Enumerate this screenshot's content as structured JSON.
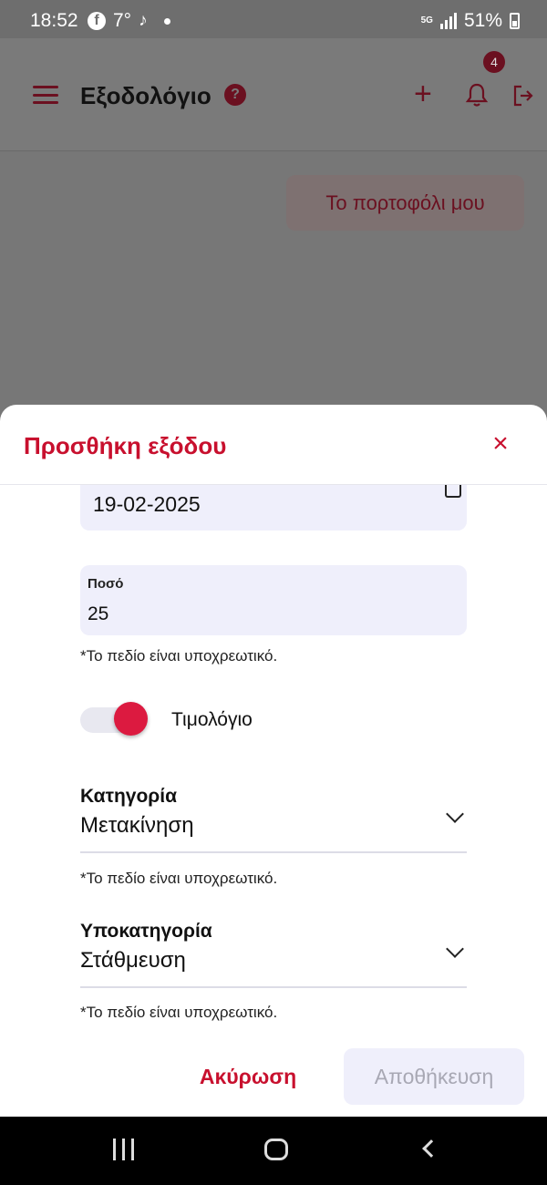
{
  "status_bar": {
    "time": "18:52",
    "temperature": "7°",
    "network": "5G",
    "battery": "51%"
  },
  "app_bar": {
    "title": "Εξοδολόγιο",
    "notification_count": "4"
  },
  "wallet_button": "Το πορτοφόλι μου",
  "sheet": {
    "title": "Προσθήκη εξόδου",
    "date_value": "19-02-2025",
    "amount_label": "Ποσό",
    "amount_value": "25",
    "required_hint": "*Το πεδίο είναι υποχρεωτικό.",
    "invoice_label": "Τιμολόγιο",
    "invoice_enabled": true,
    "category_label": "Κατηγορία",
    "category_value": "Μετακίνηση",
    "subcategory_label": "Υποκατηγορία",
    "subcategory_value": "Στάθμευση",
    "cancel_label": "Ακύρωση",
    "save_label": "Αποθήκευση"
  },
  "colors": {
    "accent": "#c8102e",
    "toggle_on": "#dc1a40",
    "field_bg": "#efeffb"
  }
}
